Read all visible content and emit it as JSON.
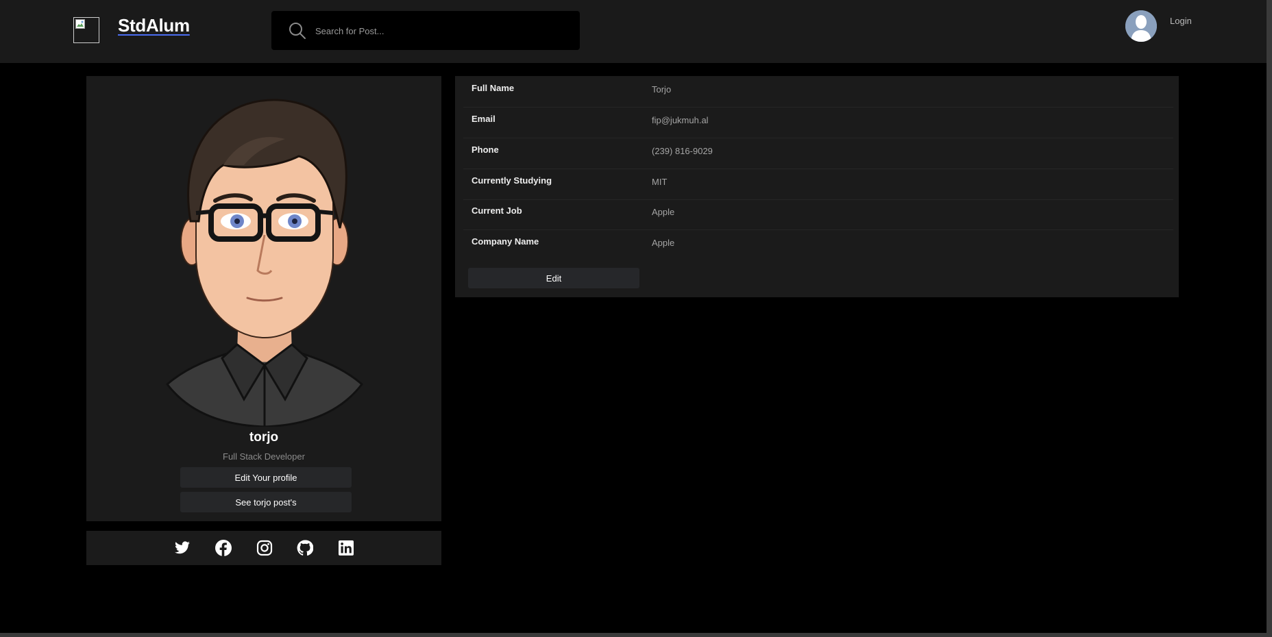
{
  "header": {
    "brand": "StdAlum",
    "search_placeholder": "Search for Post...",
    "login_label": "Login"
  },
  "profile": {
    "username": "torjo",
    "role": "Full Stack Developer",
    "edit_profile_label": "Edit Your profile",
    "see_posts_label": "See torjo post's"
  },
  "social": {
    "icons": [
      "twitter-icon",
      "facebook-icon",
      "instagram-icon",
      "github-icon",
      "linkedin-icon"
    ]
  },
  "details": {
    "rows": [
      {
        "label": "Full Name",
        "value": "Torjo"
      },
      {
        "label": "Email",
        "value": "fip@jukmuh.al"
      },
      {
        "label": "Phone",
        "value": "(239) 816-9029"
      },
      {
        "label": "Currently Studying",
        "value": "MIT"
      },
      {
        "label": "Current Job",
        "value": "Apple"
      },
      {
        "label": "Company Name",
        "value": "Apple"
      }
    ],
    "edit_label": "Edit"
  },
  "colors": {
    "background": "#000000",
    "card": "#1b1b1b",
    "navbar": "#1a1a1a",
    "button": "#262729",
    "brand_underline": "#4a6cf0"
  }
}
